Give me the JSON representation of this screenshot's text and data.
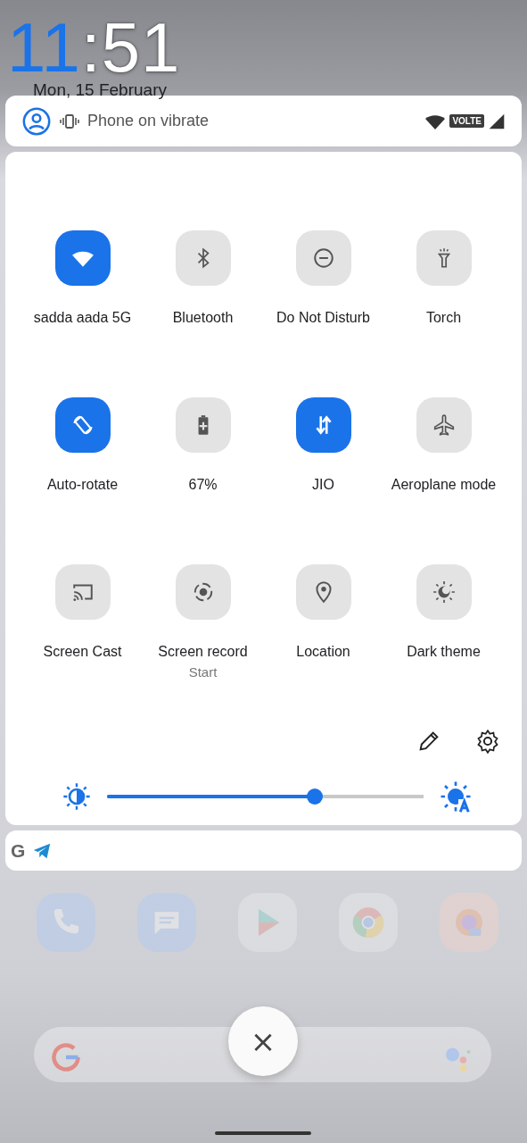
{
  "clock": {
    "hours": "11",
    "rest": ":51",
    "date": "Mon, 15 February"
  },
  "status_bar": {
    "ringer": "Phone on vibrate",
    "network_badge": "VOLTE"
  },
  "tiles": [
    {
      "kind": "wifi",
      "label": "sadda aada 5G",
      "on": true
    },
    {
      "kind": "bluetooth",
      "label": "Bluetooth",
      "on": false
    },
    {
      "kind": "dnd",
      "label": "Do Not Disturb",
      "on": false
    },
    {
      "kind": "torch",
      "label": "Torch",
      "on": false
    },
    {
      "kind": "rotate",
      "label": "Auto-rotate",
      "on": true
    },
    {
      "kind": "battery",
      "label": "67%",
      "on": false
    },
    {
      "kind": "data",
      "label": "JIO",
      "on": true
    },
    {
      "kind": "plane",
      "label": "Aeroplane mode",
      "on": false
    },
    {
      "kind": "cast",
      "label": "Screen Cast",
      "on": false
    },
    {
      "kind": "record",
      "label": "Screen record",
      "sublabel": "Start",
      "on": false
    },
    {
      "kind": "location",
      "label": "Location",
      "on": false
    },
    {
      "kind": "theme",
      "label": "Dark theme",
      "on": false
    }
  ],
  "brightness": {
    "level": 0.655
  },
  "notification_icons": [
    {
      "kind": "letter",
      "text": "G"
    },
    {
      "kind": "plane"
    }
  ],
  "dock": [
    {
      "kind": "phone"
    },
    {
      "kind": "messages"
    },
    {
      "kind": "store"
    },
    {
      "kind": "browser"
    },
    {
      "kind": "fox"
    }
  ],
  "close_button": {
    "text": "×"
  }
}
